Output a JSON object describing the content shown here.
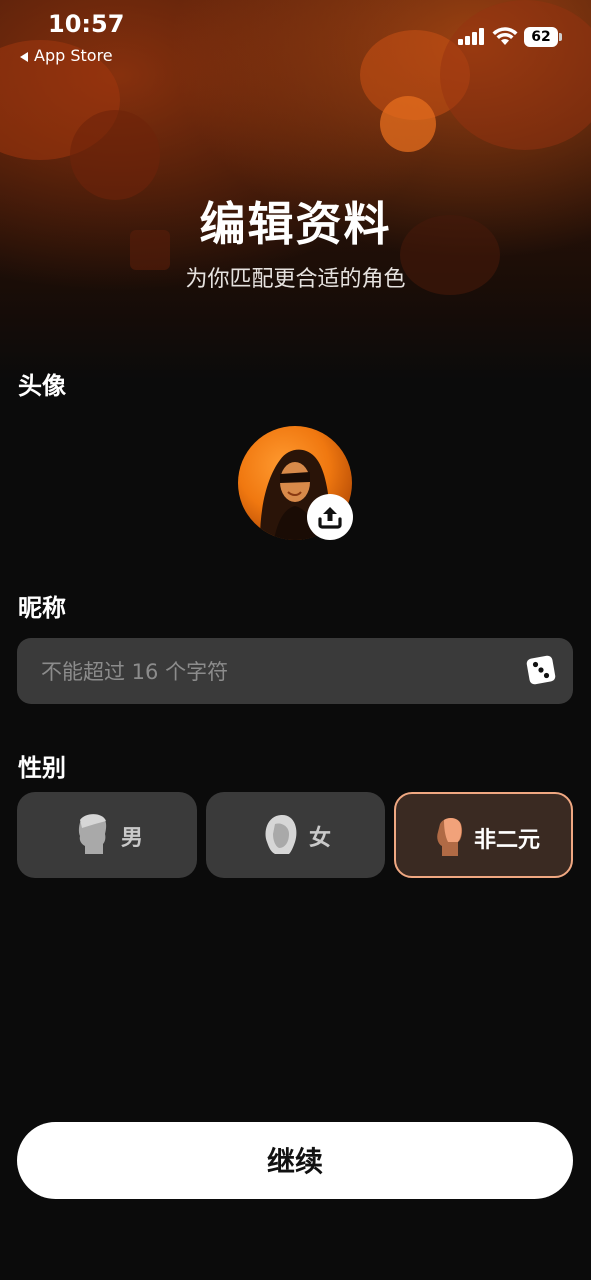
{
  "status_bar": {
    "time": "10:57",
    "back_label": "App Store",
    "battery": "62"
  },
  "header": {
    "title": "编辑资料",
    "subtitle": "为你匹配更合适的角色"
  },
  "avatar_section": {
    "label": "头像"
  },
  "nickname_section": {
    "label": "昵称",
    "placeholder": "不能超过 16 个字符",
    "value": ""
  },
  "gender_section": {
    "label": "性别",
    "options": [
      {
        "label": "男",
        "selected": false
      },
      {
        "label": "女",
        "selected": false
      },
      {
        "label": "非二元",
        "selected": true
      }
    ]
  },
  "footer": {
    "continue_label": "继续"
  },
  "colors": {
    "background": "#0b0b0b",
    "field": "#3a3a3a",
    "accent": "#f0a882"
  }
}
